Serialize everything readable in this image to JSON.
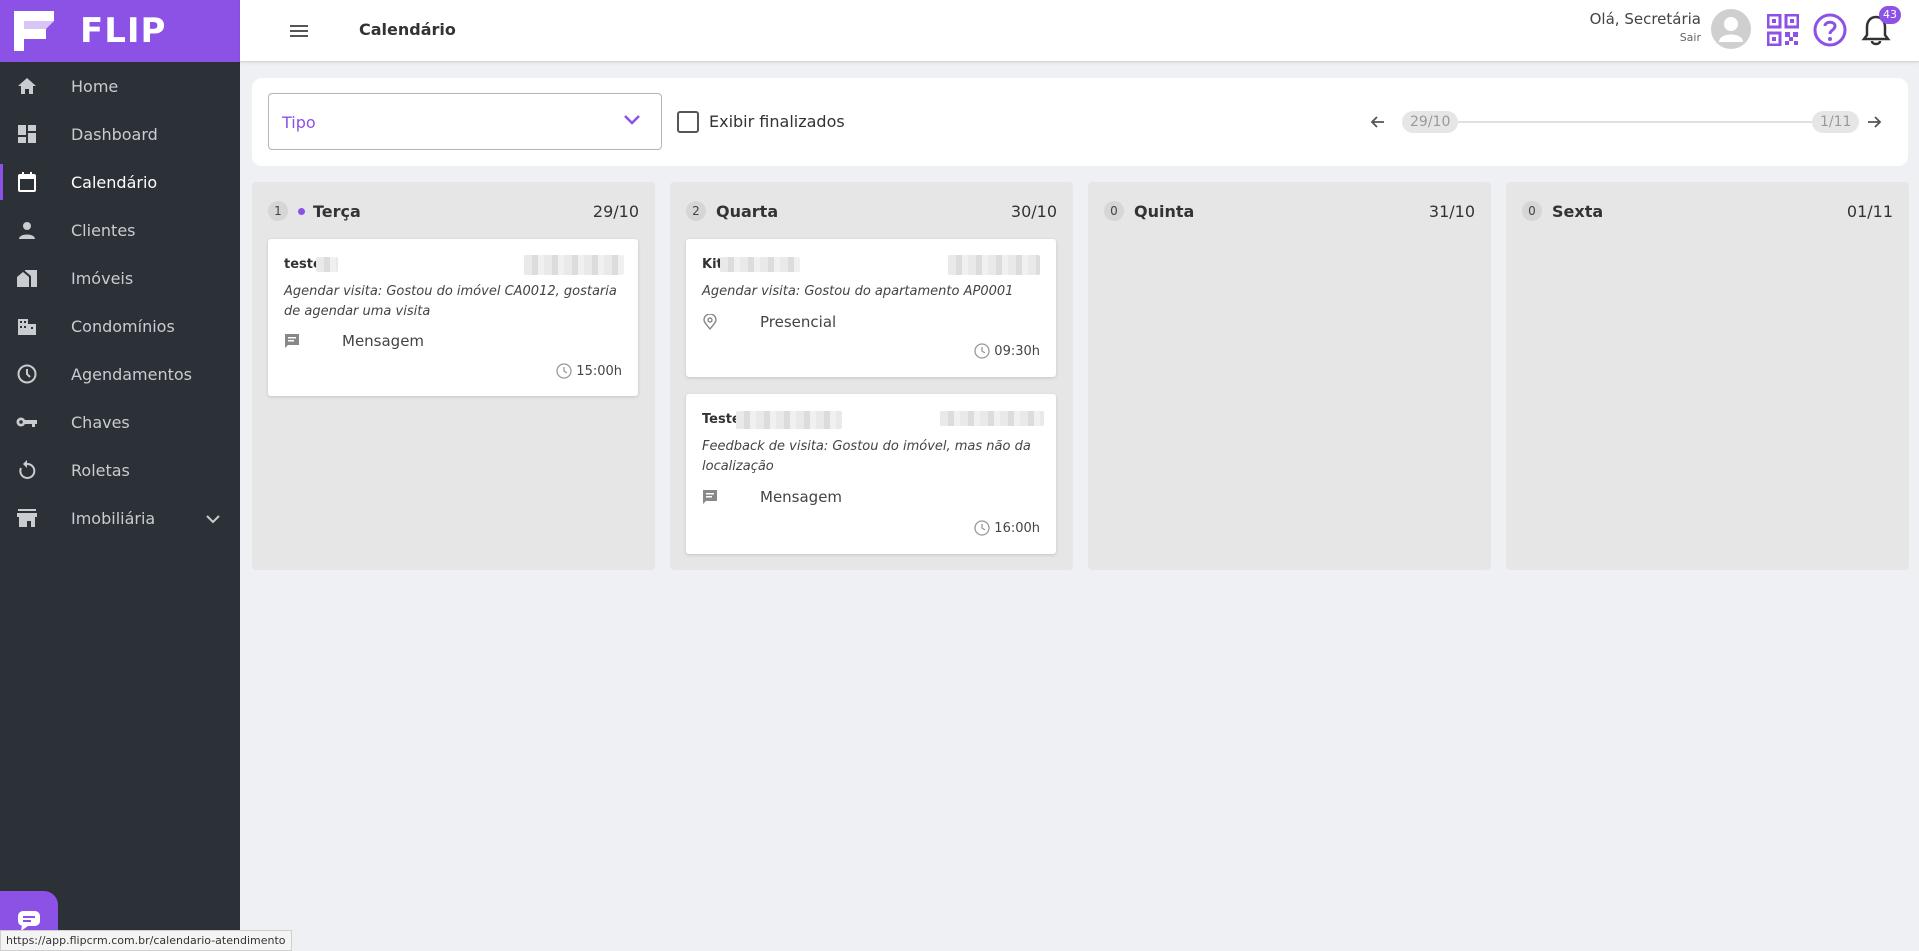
{
  "app": {
    "logo_text": "FLIP"
  },
  "sidebar": {
    "items": [
      {
        "label": "Home",
        "icon": "home-icon"
      },
      {
        "label": "Dashboard",
        "icon": "dashboard-icon"
      },
      {
        "label": "Calendário",
        "icon": "calendar-icon",
        "active": true
      },
      {
        "label": "Clientes",
        "icon": "person-icon"
      },
      {
        "label": "Imóveis",
        "icon": "house-icon"
      },
      {
        "label": "Condomínios",
        "icon": "building-icon"
      },
      {
        "label": "Agendamentos",
        "icon": "clock-icon"
      },
      {
        "label": "Chaves",
        "icon": "key-icon"
      },
      {
        "label": "Roletas",
        "icon": "rotate-icon"
      },
      {
        "label": "Imobiliária",
        "icon": "store-icon"
      }
    ]
  },
  "header": {
    "title": "Calendário",
    "greeting": "Olá, Secretária",
    "logout": "Sair",
    "notification_count": "43"
  },
  "filters": {
    "tipo_label": "Tipo",
    "show_finished_label": "Exibir finalizados",
    "range_start": "29/10",
    "range_end": "1/11"
  },
  "columns": [
    {
      "count": "1",
      "day": "Terça",
      "date": "29/10",
      "today": true,
      "cards": [
        {
          "name": "teste",
          "description": "Agendar visita: Gostou do imóvel CA0012, gostaria de agendar uma visita",
          "kind": "Mensagem",
          "kind_icon": "message-icon",
          "time": "15:00h"
        }
      ]
    },
    {
      "count": "2",
      "day": "Quarta",
      "date": "30/10",
      "today": false,
      "cards": [
        {
          "name": "Kit",
          "description": "Agendar visita: Gostou do apartamento AP0001",
          "kind": "Presencial",
          "kind_icon": "location-pin-icon",
          "time": "09:30h"
        },
        {
          "name": "Teste",
          "description": "Feedback de visita: Gostou do imóvel, mas não da localização",
          "kind": "Mensagem",
          "kind_icon": "message-icon",
          "time": "16:00h"
        }
      ]
    },
    {
      "count": "0",
      "day": "Quinta",
      "date": "31/10",
      "today": false,
      "cards": []
    },
    {
      "count": "0",
      "day": "Sexta",
      "date": "01/11",
      "today": false,
      "cards": []
    }
  ],
  "statusbar": {
    "url": "https://app.flipcrm.com.br/calendario-atendimento"
  },
  "colors": {
    "accent": "#8c52e6",
    "sidebar_bg": "#2c3138",
    "page_bg": "#eef0f4"
  }
}
